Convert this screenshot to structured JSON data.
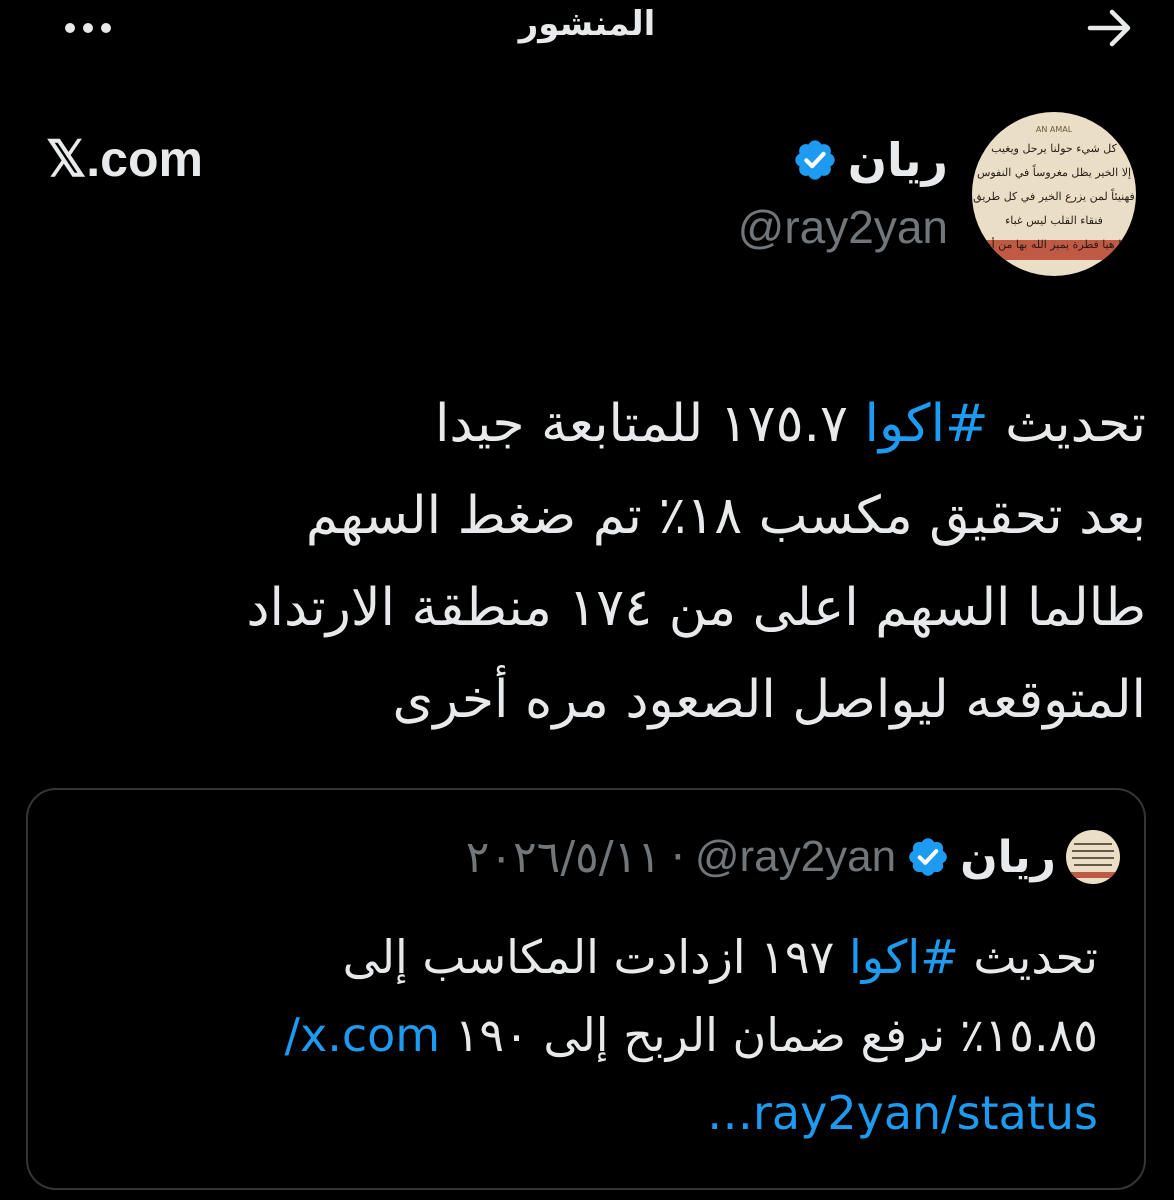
{
  "header": {
    "title": "المنشور",
    "back_icon": "arrow-right-icon",
    "more_icon": "more-dots-icon"
  },
  "post": {
    "author": {
      "name": "ريان",
      "handle": "@ray2yan",
      "verified": true,
      "avatar_text": [
        "كل شيء حولنا يرحل ويغيب",
        "إلا الخير يظل مغروساً في النفوس",
        "فهنيئاً لمن يزرع الخير في كل طريق",
        "فنقاء القلب ليس غباء",
        "إنما هيا فطرة يميز الله بها من أحب"
      ]
    },
    "site_label": "𝕏.com",
    "lines": [
      {
        "before": "تحديث ",
        "hashtag": "#اكوا",
        "after": " ١٧٥.٧ للمتابعة جيدا"
      },
      {
        "text": "بعد تحقيق مكسب ١٨٪   تم ضغط السهم"
      },
      {
        "text": "طالما السهم اعلى من ١٧٤ منطقة الارتداد"
      },
      {
        "text": "المتوقعه ليواصل الصعود مره أخرى"
      }
    ]
  },
  "quote": {
    "author_name": "ريان",
    "handle": "@ray2yan",
    "separator": "·",
    "date": "٢٠٢٦/٥/١١",
    "line1_before": "تحديث ",
    "line1_hashtag": "#اكوا",
    "line1_after": " ١٩٧  ازدادت المكاسب إلى",
    "line2_text": "١٥.٨٥٪  نرفع ضمان الربح إلى ١٩٠ ",
    "line2_link": "x.com/",
    "line3_link": "ray2yan/status…"
  },
  "colors": {
    "background": "#000000",
    "text": "#e7e9ea",
    "secondary": "#71767b",
    "accent": "#1d9bf0",
    "border": "#333639"
  }
}
